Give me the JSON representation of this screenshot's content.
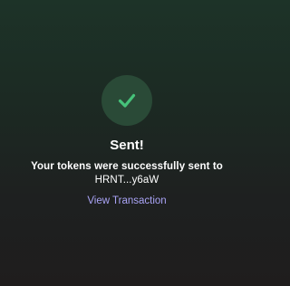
{
  "status": {
    "icon": "checkmark-icon",
    "title": "Sent!",
    "message": "Your tokens were successfully sent to",
    "recipient": "HRNT...y6aW"
  },
  "actions": {
    "view_transaction": "View Transaction"
  },
  "colors": {
    "accent_green": "#46c27a",
    "badge_bg": "#2a4a37",
    "link": "#a9a3f5"
  }
}
